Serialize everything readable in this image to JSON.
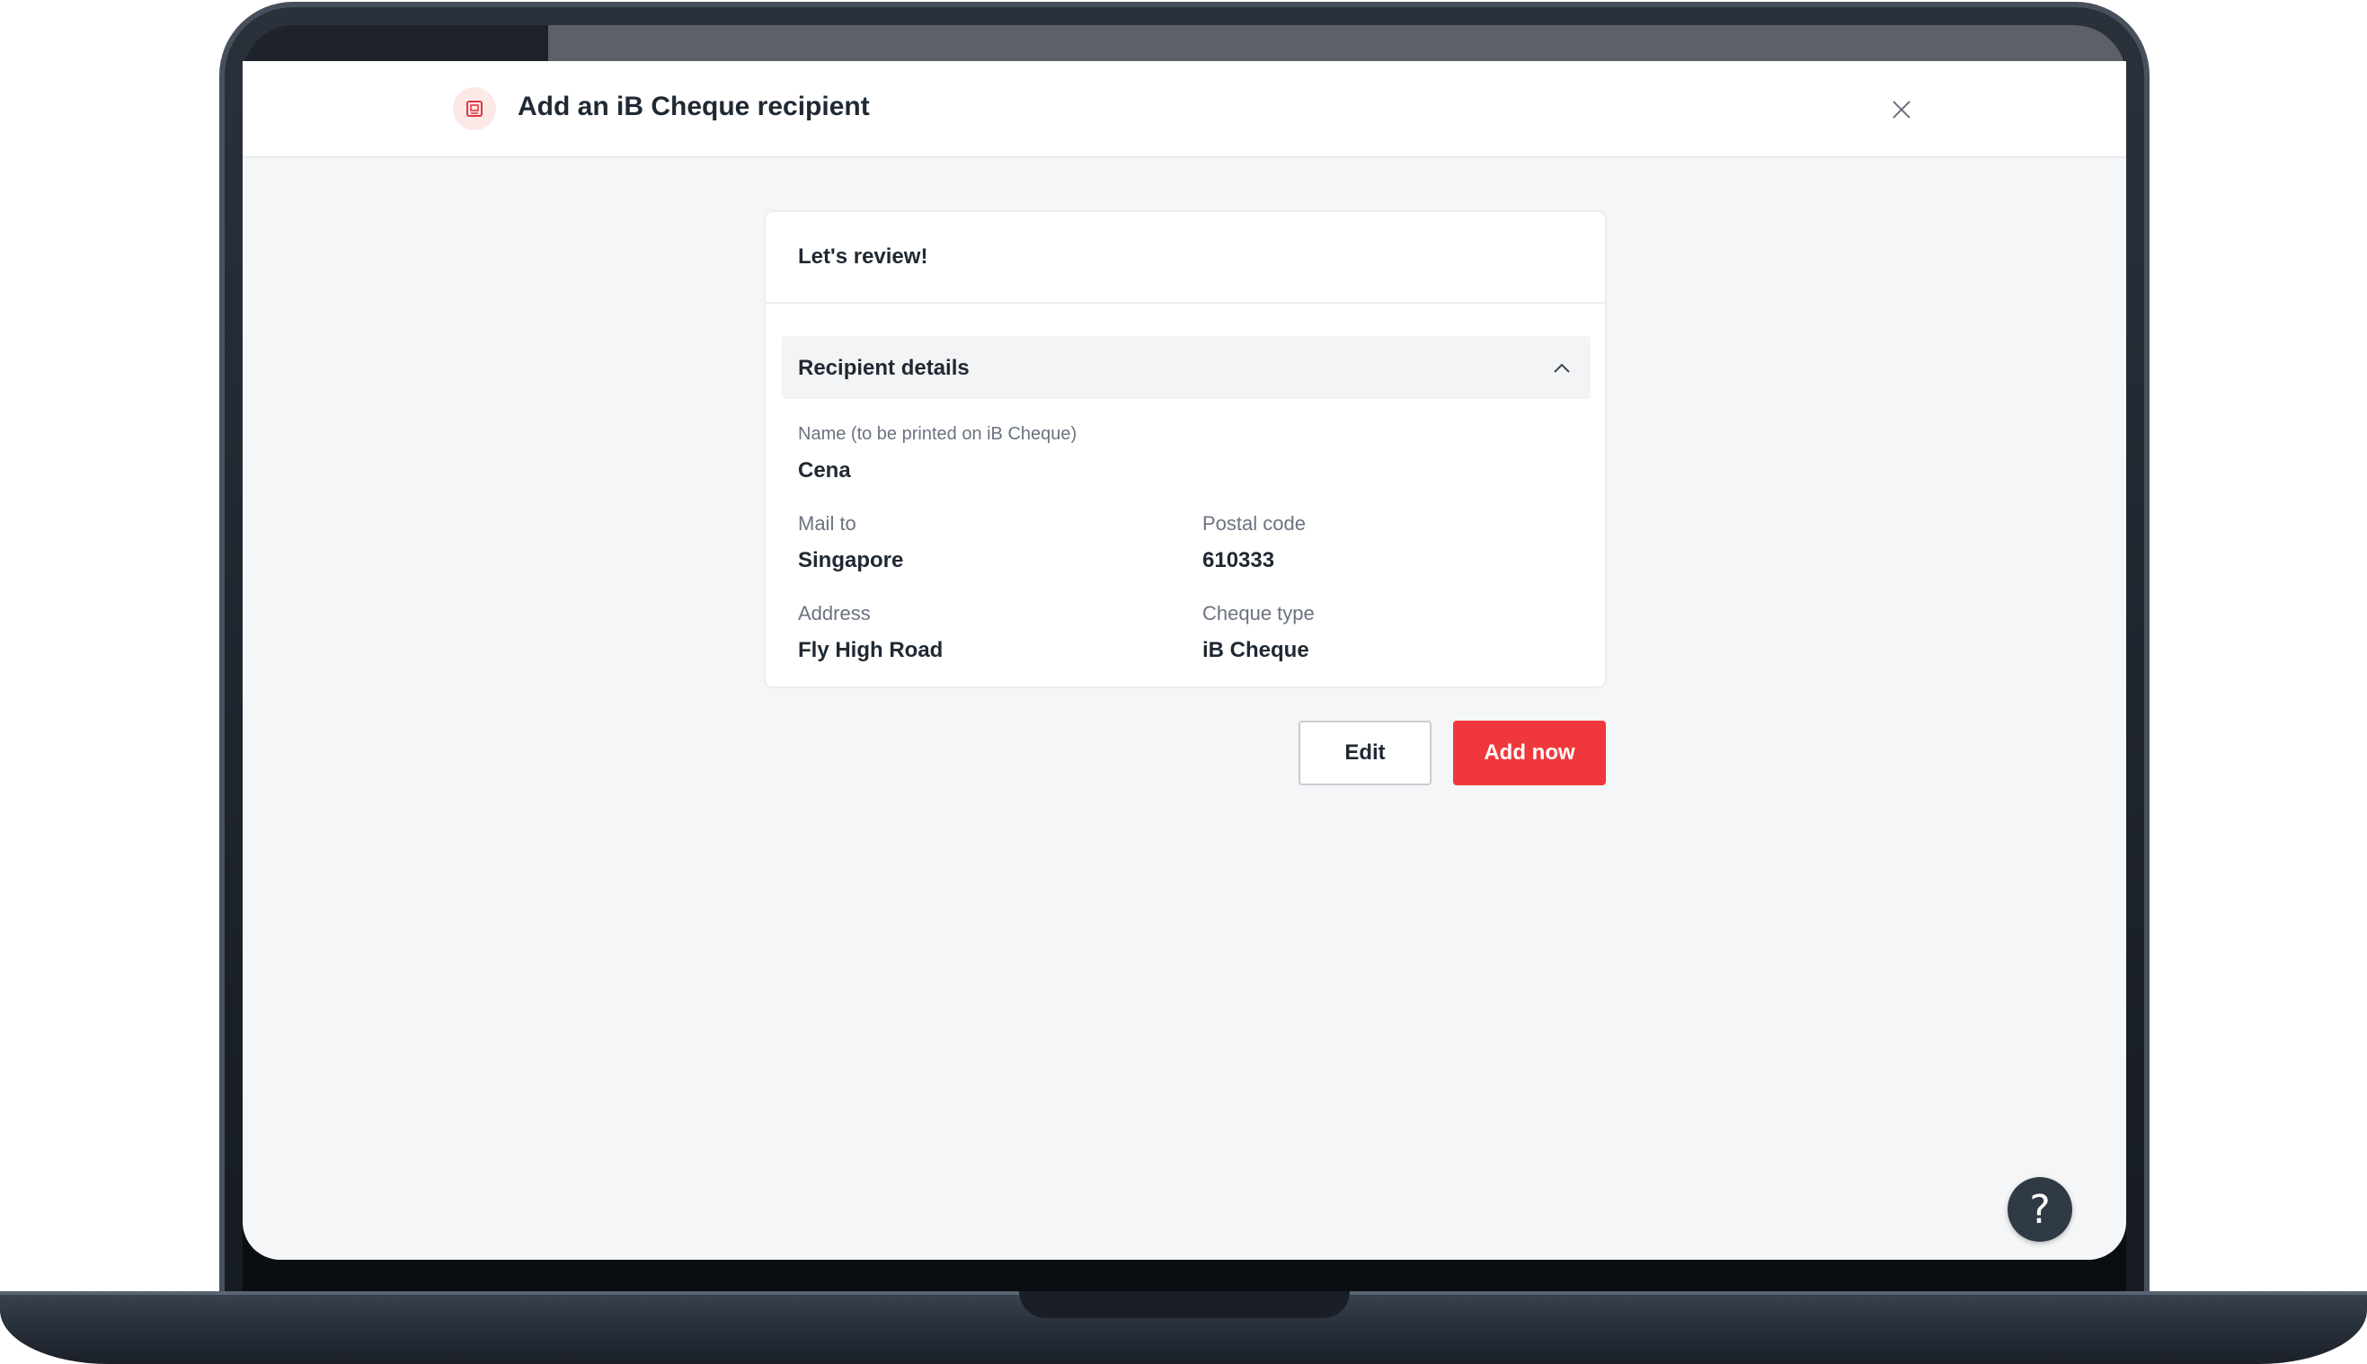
{
  "header": {
    "title": "Add an iB Cheque recipient",
    "icon": "cheque-icon",
    "close_icon": "close-icon"
  },
  "review": {
    "title": "Let's review!",
    "section": {
      "title": "Recipient details",
      "toggle_icon": "chevron-up-icon",
      "expanded": true
    },
    "fields": {
      "name": {
        "label": "Name (to be printed on iB Cheque)",
        "value": "Cena"
      },
      "mail_to": {
        "label": "Mail to",
        "value": "Singapore"
      },
      "postal_code": {
        "label": "Postal code",
        "value": "610333"
      },
      "address": {
        "label": "Address",
        "value": "Fly High Road"
      },
      "cheque_type": {
        "label": "Cheque type",
        "value": "iB Cheque"
      }
    }
  },
  "actions": {
    "edit_label": "Edit",
    "add_label": "Add now"
  },
  "help": {
    "label": "?",
    "icon": "help-icon"
  },
  "colors": {
    "primary": "#f0383c",
    "text": "#1f2933",
    "muted": "#6b7280",
    "background": "#f5f6f7"
  }
}
